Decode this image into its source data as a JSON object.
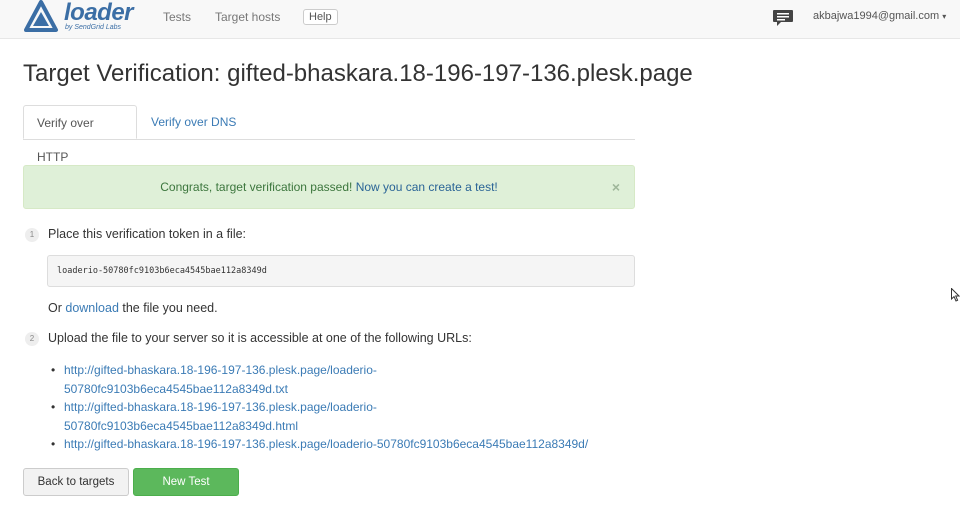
{
  "brand": {
    "name": "loader",
    "tagline": "by SendGrid Labs"
  },
  "nav": {
    "tests": "Tests",
    "target_hosts": "Target hosts",
    "help": "Help",
    "user_email": "akbajwa1994@gmail.com",
    "chat_icon": "chat-icon",
    "caret_icon": "caret-down-icon",
    "caret_glyph": "▾"
  },
  "page": {
    "title": "Target Verification: gifted-bhaskara.18-196-197-136.plesk.page",
    "tabs": [
      {
        "label": "Verify over HTTP",
        "active": true
      },
      {
        "label": "Verify over DNS",
        "active": false
      }
    ]
  },
  "alert": {
    "text": "Congrats, target verification passed!",
    "link": "Now you can create a test!",
    "close": "×"
  },
  "steps": [
    {
      "number": "1",
      "text": "Place this verification token in a file:"
    },
    {
      "number": "2",
      "text": "Upload the file to your server so it is accessible at one of the following URLs:"
    }
  ],
  "token": "loaderio-50780fc9103b6eca4545bae112a8349d",
  "download": {
    "prefix": "Or",
    "link": "download",
    "suffix": "the file you need."
  },
  "urls": [
    "http://gifted-bhaskara.18-196-197-136.plesk.page/loaderio-",
    "50780fc9103b6eca4545bae112a8349d.txt",
    "http://gifted-bhaskara.18-196-197-136.plesk.page/loaderio-",
    "50780fc9103b6eca4545bae112a8349d.html",
    "http://gifted-bhaskara.18-196-197-136.plesk.page/loaderio-50780fc9103b6eca4545bae112a8349d/"
  ],
  "bullet": "•",
  "buttons": {
    "back": "Back to targets",
    "new_test": "New Test"
  },
  "colors": {
    "brand": "#3b6ea5",
    "link": "#3b7bb5",
    "success_bg": "#dff0d8",
    "success_text": "#3c763d",
    "primary_button": "#5cb85c"
  }
}
